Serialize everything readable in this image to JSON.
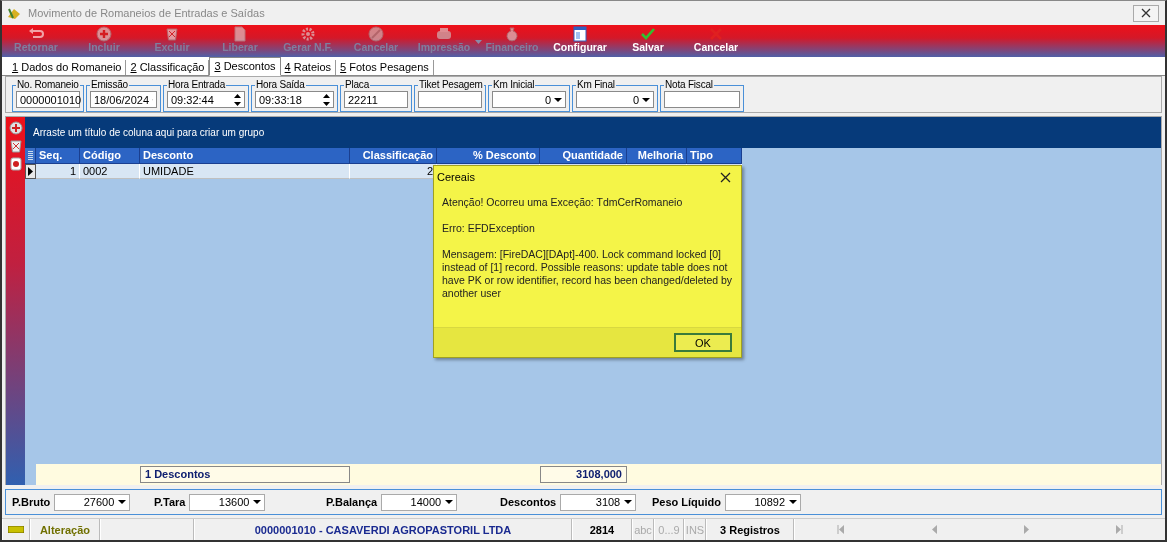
{
  "window": {
    "title": "Movimento de Romaneios de Entradas e Saídas"
  },
  "toolbar": [
    {
      "label": "Retornar",
      "disabled": true
    },
    {
      "label": "Incluir",
      "disabled": true
    },
    {
      "label": "Excluir",
      "disabled": true
    },
    {
      "label": "Liberar",
      "disabled": true
    },
    {
      "label": "Gerar N.F.",
      "disabled": true
    },
    {
      "label": "Cancelar",
      "disabled": true
    },
    {
      "label": "Impressão",
      "disabled": true,
      "menu": true
    },
    {
      "label": "Financeiro",
      "disabled": true
    },
    {
      "label": "Configurar",
      "disabled": false
    },
    {
      "label": "Salvar",
      "disabled": false
    },
    {
      "label": "Cancelar",
      "disabled": false
    }
  ],
  "tabs": [
    {
      "key": "1",
      "label": "Dados do Romaneio",
      "selected": false
    },
    {
      "key": "2",
      "label": "Classificação",
      "selected": false
    },
    {
      "key": "3",
      "label": "Descontos",
      "selected": true
    },
    {
      "key": "4",
      "label": "Rateios",
      "selected": false
    },
    {
      "key": "5",
      "label": "Fotos Pesagens",
      "selected": false
    }
  ],
  "fields": [
    {
      "label": "No. Romaneio",
      "kind": "text",
      "value": "0000001010"
    },
    {
      "label": "Emissão",
      "kind": "date",
      "value": "18/06/2024"
    },
    {
      "label": "Hora Entrada",
      "kind": "time",
      "value": "09:32:44"
    },
    {
      "label": "Hora Saída",
      "kind": "time",
      "value": "09:33:18"
    },
    {
      "label": "Placa",
      "kind": "text",
      "value": "22211"
    },
    {
      "label": "Tiket Pesagem",
      "kind": "text"
    },
    {
      "label": "Km Inicial",
      "kind": "number",
      "value": "0"
    },
    {
      "label": "Km Final",
      "kind": "number",
      "value": "0"
    },
    {
      "label": "Nota Fiscal",
      "kind": "text"
    }
  ],
  "grid": {
    "group_hint": "Arraste um título de coluna aqui para criar um grupo",
    "columns": [
      {
        "label": "Seq."
      },
      {
        "label": "Código"
      },
      {
        "label": "Desconto"
      },
      {
        "label": "Classificação"
      },
      {
        "label": "% Desconto"
      },
      {
        "label": "Quantidade"
      },
      {
        "label": "Melhoria"
      },
      {
        "label": "Tipo"
      }
    ],
    "footer": {
      "count": "1 Descontos",
      "total": "3108,000"
    },
    "rows": [
      {
        "selected": true,
        "cells": [
          "1",
          "0002",
          "UMIDADE",
          "2"
        ]
      }
    ]
  },
  "dialog": {
    "title": "Cereais",
    "paragraphs": [
      "Atenção! Ocorreu uma Exceção: TdmCerRomaneio",
      "Erro: EFDException",
      " Mensagem: [FireDAC][DApt]-400. Lock command locked [0] instead of [1] record. Possible reasons: update table does not have PK or row identifier, record has been changed/deleted by another user"
    ],
    "button": "OK"
  },
  "weights": [
    {
      "label": "P.Bruto",
      "value": "27600"
    },
    {
      "label": "P.Tara",
      "value": "13600"
    },
    {
      "label": "P.Balança",
      "value": "14000"
    },
    {
      "label": "Descontos",
      "value": "3108"
    },
    {
      "label": "Peso Líquido",
      "value": "10892"
    }
  ],
  "status_bar": {
    "mode": "Alteração",
    "record": "0000001010 - CASAVERDI AGROPASTORIL LTDA",
    "code": "2814",
    "indicators": [
      {
        "label": "abc",
        "on": false
      },
      {
        "label": "0...9",
        "on": false
      },
      {
        "label": "INS",
        "on": false
      }
    ],
    "count": "3 Registros"
  }
}
